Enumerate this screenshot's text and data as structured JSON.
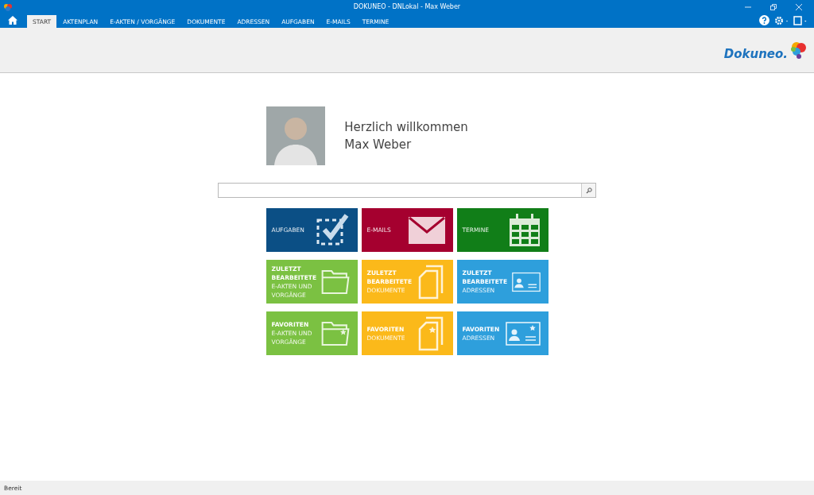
{
  "window": {
    "title": "DOKUNEO - DNLokal - Max Weber"
  },
  "tabs": [
    {
      "label": "START",
      "selected": true
    },
    {
      "label": "AKTENPLAN",
      "selected": false
    },
    {
      "label": "E-AKTEN / VORGÄNGE",
      "selected": false
    },
    {
      "label": "DOKUMENTE",
      "selected": false
    },
    {
      "label": "ADRESSEN",
      "selected": false
    },
    {
      "label": "AUFGABEN",
      "selected": false
    },
    {
      "label": "E-MAILS",
      "selected": false
    },
    {
      "label": "TERMINE",
      "selected": false
    }
  ],
  "logo": {
    "text": "Dokuneo."
  },
  "welcome": {
    "greeting": "Herzlich willkommen",
    "name": "Max Weber"
  },
  "tiles": [
    {
      "label": "AUFGABEN",
      "kind": "check",
      "color": "#0b4f85"
    },
    {
      "label": "E-MAILS",
      "kind": "mail",
      "color": "#a5002f"
    },
    {
      "label": "TERMINE",
      "kind": "calendar",
      "color": "#117e18"
    },
    {
      "title": "ZULETZT BEARBEITETE",
      "label": "E-AKTEN UND VORGÄNGE",
      "kind": "folder",
      "star": false,
      "color": "#7bc142"
    },
    {
      "title": "ZULETZT BEARBEITETE",
      "label": "DOKUMENTE",
      "kind": "docs",
      "star": false,
      "color": "#fbb91a"
    },
    {
      "title": "ZULETZT BEARBEITETE",
      "label": "ADRESSEN",
      "kind": "card",
      "star": false,
      "color": "#2e9fdc"
    },
    {
      "title": "FAVORITEN",
      "label": "E-AKTEN UND VORGÄNGE",
      "kind": "folder",
      "star": true,
      "color": "#7bc142"
    },
    {
      "title": "FAVORITEN",
      "label": "DOKUMENTE",
      "kind": "docs",
      "star": true,
      "color": "#fbb91a"
    },
    {
      "title": "FAVORITEN",
      "label": "ADRESSEN",
      "kind": "card",
      "star": true,
      "color": "#2e9fdc"
    }
  ],
  "status_bar": {
    "text": "Bereit"
  }
}
